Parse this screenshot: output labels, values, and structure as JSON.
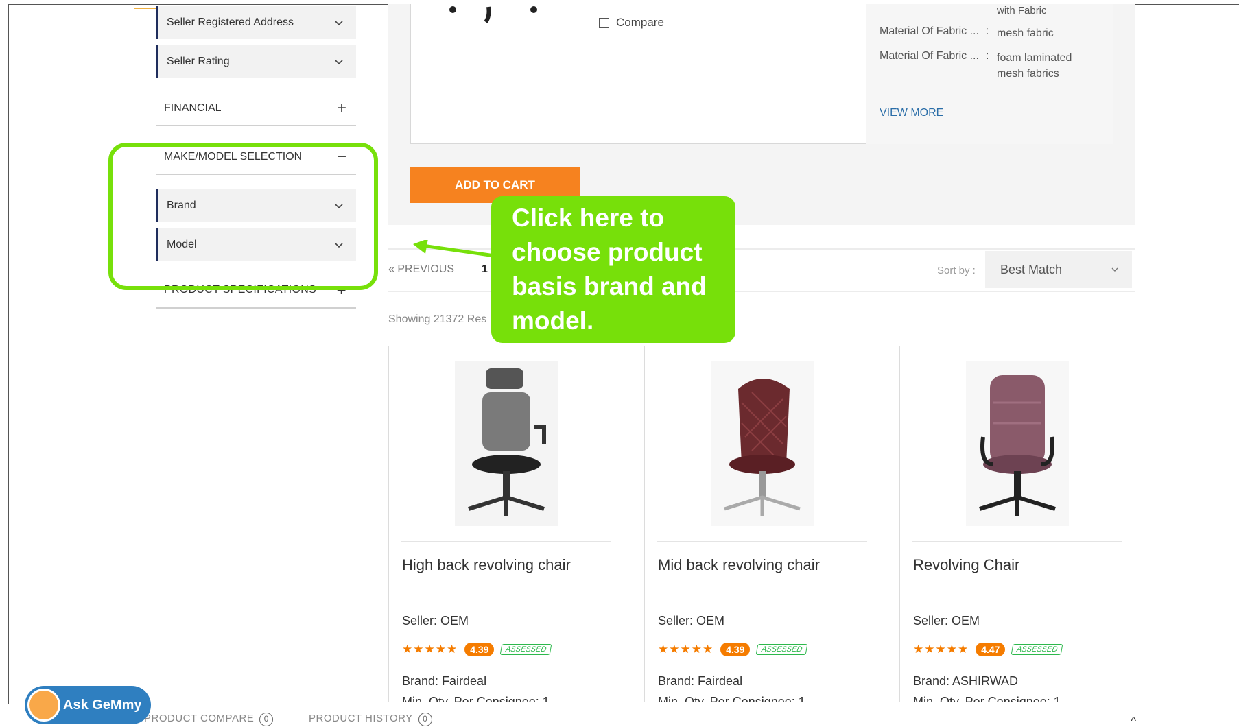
{
  "sidebar": {
    "seller_address": "Seller Registered Address",
    "seller_rating": "Seller Rating",
    "financial": "FINANCIAL",
    "make_model": "MAKE/MODEL SELECTION",
    "brand": "Brand",
    "model": "Model",
    "product_specs": "PRODUCT SPECIFICATIONS"
  },
  "top_product": {
    "compare_label": "Compare",
    "specs": [
      {
        "key": "",
        "value": "with Fabric"
      },
      {
        "key": "Material Of Fabric ...",
        "value": "mesh fabric"
      },
      {
        "key": "Material Of Fabric ...",
        "value": "foam laminated mesh fabrics"
      }
    ],
    "view_more": "VIEW MORE",
    "add_to_cart": "ADD TO CART"
  },
  "pagination": {
    "previous": "« PREVIOUS",
    "current_page": "1",
    "sort_label": "Sort by :",
    "sort_value": "Best Match"
  },
  "results": {
    "showing": "Showing 21372 Res"
  },
  "callout": {
    "lines": [
      "Click here to",
      "choose product",
      "basis brand and",
      "model."
    ]
  },
  "products": [
    {
      "title": "High back revolving chair",
      "seller_label": "Seller:",
      "seller": "OEM",
      "rating": "4.39",
      "rating_fraction": 0.878,
      "assessed": "ASSESSED",
      "brand": "Brand: Fairdeal",
      "min_qty": "Min. Qty. Per Consignee: 1"
    },
    {
      "title": "Mid back revolving chair",
      "seller_label": "Seller:",
      "seller": "OEM",
      "rating": "4.39",
      "rating_fraction": 0.878,
      "assessed": "ASSESSED",
      "brand": "Brand: Fairdeal",
      "min_qty": "Min. Qty. Per Consignee: 1"
    },
    {
      "title": "Revolving Chair",
      "seller_label": "Seller:",
      "seller": "OEM",
      "rating": "4.47",
      "rating_fraction": 0.894,
      "assessed": "ASSESSED",
      "brand": "Brand: ASHIRWAD",
      "min_qty": "Min. Qty. Per Consignee: 1"
    }
  ],
  "bottom_bar": {
    "product_compare": "PRODUCT COMPARE",
    "product_compare_count": "0",
    "product_history": "PRODUCT HISTORY",
    "product_history_count": "0"
  },
  "ask": {
    "label": "Ask GeMmy"
  },
  "colors": {
    "accent_green": "#77e00a",
    "cart_orange": "#f6821f",
    "rating_orange": "#f57c00",
    "assessed_green": "#2db84c",
    "navy": "#1f2d5c",
    "ask_blue": "#2f7fc0"
  }
}
